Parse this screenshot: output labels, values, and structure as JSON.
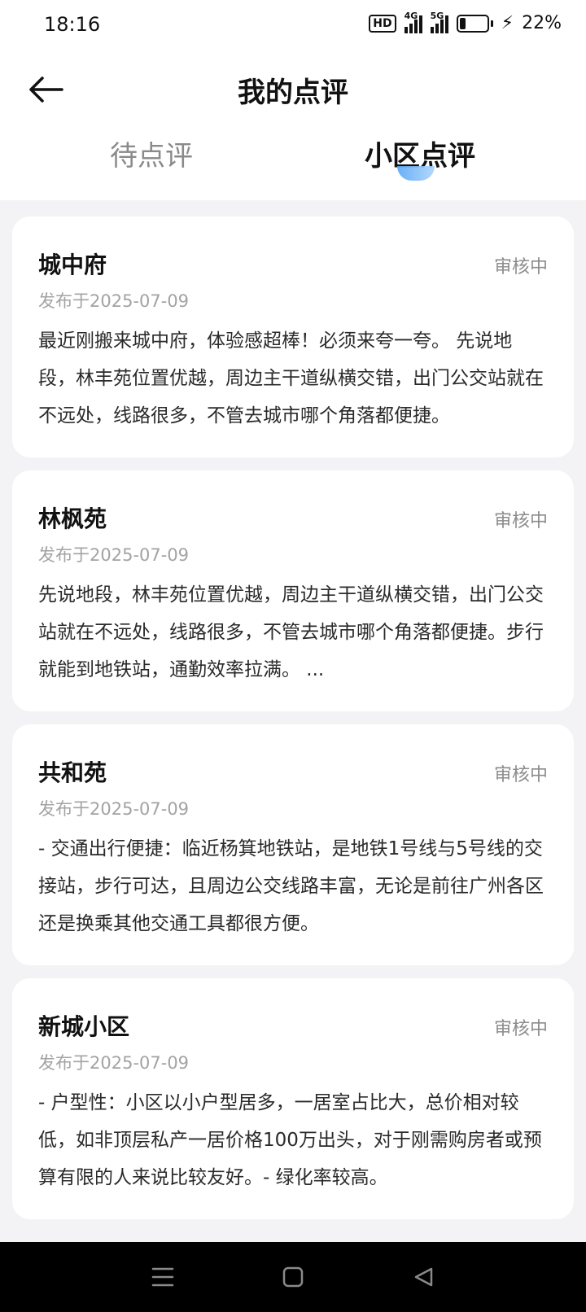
{
  "status_bar": {
    "time": "18:16",
    "hd_label": "HD",
    "signal1_label": "4G",
    "signal2_label": "5G",
    "battery_percent": "22%",
    "battery_level": 0.22
  },
  "header": {
    "title": "我的点评",
    "back_icon": "arrow-left-icon"
  },
  "tabs": [
    {
      "label": "待点评",
      "active": false
    },
    {
      "label": "小区点评",
      "active": true
    }
  ],
  "reviews": [
    {
      "name": "城中府",
      "status": "审核中",
      "date": "发布于2025-07-09",
      "text": "最近刚搬来城中府，体验感超棒！必须来夸一夸。 先说地段，林丰苑位置优越，周边主干道纵横交错，出门公交站就在不远处，线路很多，不管去城市哪个角落都便捷。"
    },
    {
      "name": "林枫苑",
      "status": "审核中",
      "date": "发布于2025-07-09",
      "text": "先说地段，林丰苑位置优越，周边主干道纵横交错，出门公交站就在不远处，线路很多，不管去城市哪个角落都便捷。步行就能到地铁站，通勤效率拉满。 ..."
    },
    {
      "name": "共和苑",
      "status": "审核中",
      "date": "发布于2025-07-09",
      "text": "- 交通出行便捷：临近杨箕地铁站，是地铁1号线与5号线的交接站，步行可达，且周边公交线路丰富，无论是前往广州各区还是换乘其他交通工具都很方便。"
    },
    {
      "name": "新城小区",
      "status": "审核中",
      "date": "发布于2025-07-09",
      "text": "- 户型性：小区以小户型居多，一居室占比大，总价相对较低，如非顶层私产一居价格100万出头，对于刚需购房者或预算有限的人来说比较友好。- 绿化率较高。"
    }
  ],
  "system_nav": {
    "menu_icon": "menu-icon",
    "home_icon": "home-square-icon",
    "back_icon": "back-triangle-icon"
  }
}
